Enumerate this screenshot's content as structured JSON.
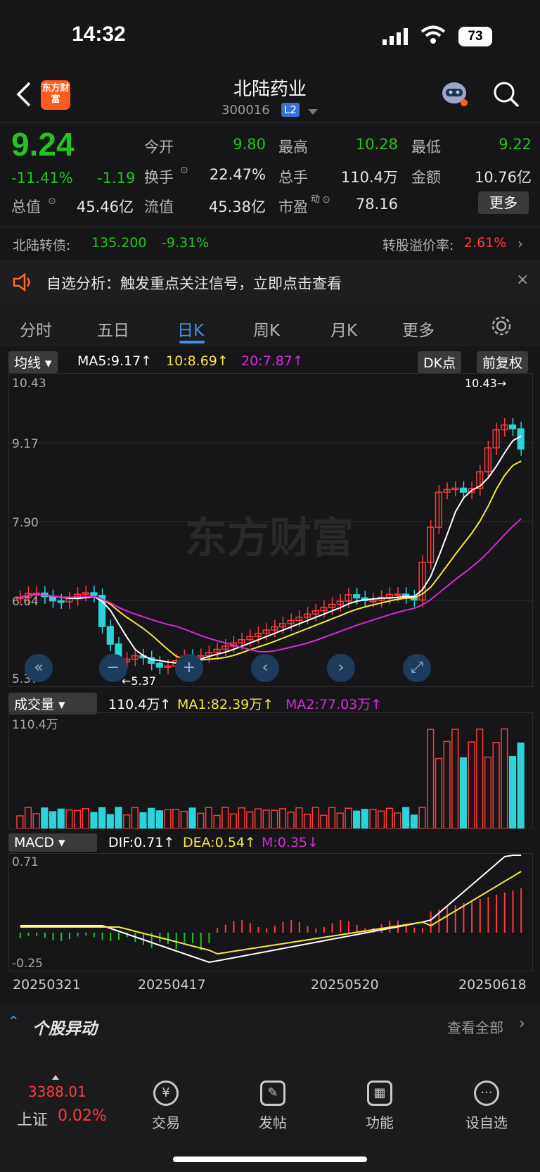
{
  "status": {
    "time": "14:32",
    "battery": "73"
  },
  "header": {
    "name": "北陆药业",
    "code": "300016",
    "level_badge": "L2",
    "logo_text": "东方财富"
  },
  "quote": {
    "price": "9.24",
    "change_pct": "-11.41%",
    "change": "-1.19",
    "open_label": "今开",
    "open": "9.80",
    "high_label": "最高",
    "high": "10.28",
    "low_label": "最低",
    "low": "9.22",
    "turnover_label": "换手",
    "turnover": "22.47%",
    "volume_label": "总手",
    "volume": "110.4万",
    "amount_label": "金额",
    "amount": "10.76亿",
    "mktcap_label": "总值",
    "mktcap": "45.46亿",
    "float_label": "流值",
    "float": "45.38亿",
    "pe_label": "市盈",
    "pe_sup": "动",
    "pe": "78.16",
    "more_label": "更多"
  },
  "bond": {
    "label": "北陆转债:",
    "price": "135.200",
    "change": "-9.31%",
    "premium_label": "转股溢价率:",
    "premium": "2.61%"
  },
  "alert": {
    "text": "自选分析：触发重点关注信号，立即点击查看"
  },
  "tabs": [
    "分时",
    "五日",
    "日K",
    "周K",
    "月K",
    "更多"
  ],
  "active_tab": "日K",
  "kline": {
    "indicator": "均线",
    "ma5": "MA5:9.17↑",
    "ma10": "10:8.69↑",
    "ma20": "20:7.87↑",
    "dk_label": "DK点",
    "adjust_label": "前复权",
    "y_top": "10.43",
    "y_mid": "9.17",
    "y_mid2": "7.90",
    "y_low": "6.64",
    "y_bottom": "5.37",
    "max_marker": "10.43→",
    "min_marker": "←5.37",
    "watermark": "东方财富"
  },
  "volume_panel": {
    "indicator": "成交量",
    "vol": "110.4万↑",
    "ma1": "MA1:82.39万↑",
    "ma2": "MA2:77.03万↑",
    "y_top": "110.4万"
  },
  "macd_panel": {
    "indicator": "MACD",
    "dif": "DIF:0.71↑",
    "dea": "DEA:0.54↑",
    "m": "M:0.35↓",
    "y_top": "0.71",
    "y_bottom": "-0.25"
  },
  "dates": [
    "20250321",
    "20250417",
    "20250520",
    "20250618"
  ],
  "movement": {
    "title": "个股异动",
    "view_all": "查看全部"
  },
  "bottom_nav": {
    "index_value": "3388.01",
    "index_name": "上证",
    "index_change": "0.02%",
    "items": [
      "交易",
      "发帖",
      "功能",
      "设自选"
    ]
  },
  "colors": {
    "up": "#ff3b3b",
    "down": "#22c322",
    "ma5": "#ffffff",
    "ma10": "#f5e642",
    "ma20": "#d62ad6",
    "accent": "#3b8fe8"
  }
}
